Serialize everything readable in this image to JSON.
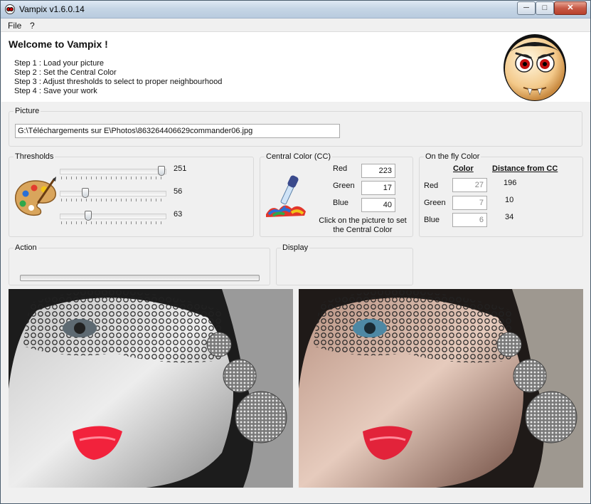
{
  "window": {
    "title": "Vampix v1.6.0.14",
    "controls": {
      "minimize": "─",
      "maximize": "□",
      "close": "✕"
    }
  },
  "menu": {
    "file": "File",
    "help": "?"
  },
  "header": {
    "welcome": "Welcome to Vampix !",
    "steps": [
      "Step 1 : Load your picture",
      "Step 2 : Set the Central Color",
      "Step 3 : Adjust thresholds to select to proper neighbourhood",
      "Step 4 : Save your work"
    ],
    "mascot_icon": "vampire-face-icon"
  },
  "picture": {
    "legend": "Picture",
    "path": "G:\\Téléchargements sur E\\Photos\\863264406629commander06.jpg"
  },
  "thresholds": {
    "legend": "Thresholds",
    "icon": "paint-palette-icon",
    "sliders": [
      {
        "value": "251",
        "level": 251
      },
      {
        "value": "56",
        "level": 56
      },
      {
        "value": "63",
        "level": 63
      }
    ],
    "max": 255
  },
  "central_color": {
    "legend": "Central Color (CC)",
    "icon": "eyedropper-icon",
    "red_label": "Red",
    "red": "223",
    "green_label": "Green",
    "green": "17",
    "blue_label": "Blue",
    "blue": "40",
    "hint_line1": "Click on the picture to set",
    "hint_line2": "the Central Color"
  },
  "on_the_fly": {
    "legend": "On the fly Color",
    "color_head": "Color",
    "distance_head": "Distance from CC",
    "red_label": "Red",
    "red": "27",
    "red_distance": "196",
    "green_label": "Green",
    "green": "7",
    "green_distance": "10",
    "blue_label": "Blue",
    "blue": "6",
    "blue_distance": "34"
  },
  "action": {
    "legend": "Action",
    "progress": 0
  },
  "display": {
    "legend": "Display"
  },
  "images": {
    "left": "processed-photo-grayscale-red-lips",
    "right": "original-photo"
  }
}
